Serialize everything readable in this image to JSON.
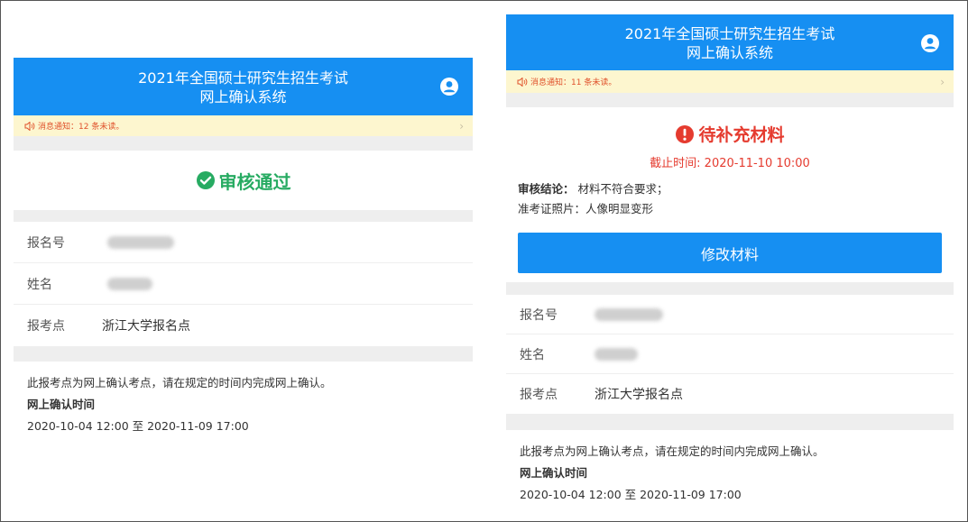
{
  "left": {
    "header": {
      "line1": "2021年全国硕士研究生招生考试",
      "line2": "网上确认系统"
    },
    "notice": {
      "text": "消息通知：12 条未读。",
      "arrow": "›"
    },
    "status": {
      "label": "审核通过",
      "color": "#27ab62"
    },
    "fields": [
      {
        "label": "报名号",
        "value": ""
      },
      {
        "label": "姓名",
        "value": ""
      },
      {
        "label": "报考点",
        "value": "浙江大学报名点"
      }
    ],
    "info": {
      "text": "此报考点为网上确认考点，请在规定的时间内完成网上确认。",
      "time_title": "网上确认时间",
      "time_range": "2020-10-04 12:00 至 2020-11-09 17:00"
    }
  },
  "right": {
    "header": {
      "line1": "2021年全国硕士研究生招生考试",
      "line2": "网上确认系统"
    },
    "notice": {
      "text": "消息通知：11 条未读。",
      "arrow": "›"
    },
    "status": {
      "label": "待补充材料",
      "color": "#e53b2f",
      "deadline": "截止时间: 2020-11-10 10:00",
      "conclusion_label": "审核结论：",
      "conclusion_value": "材料不符合要求；",
      "detail": "准考证照片：人像明显变形",
      "button": "修改材料"
    },
    "fields": [
      {
        "label": "报名号",
        "value": ""
      },
      {
        "label": "姓名",
        "value": ""
      },
      {
        "label": "报考点",
        "value": "浙江大学报名点"
      }
    ],
    "info": {
      "text": "此报考点为网上确认考点，请在规定的时间内完成网上确认。",
      "time_title": "网上确认时间",
      "time_range": "2020-10-04 12:00 至 2020-11-09 17:00"
    }
  },
  "colors": {
    "header_bg": "#168ff2",
    "notice_bg": "#fdf6cf",
    "notice_text": "#e0512b"
  },
  "icons": {
    "avatar": "user-circle-icon",
    "speaker": "speaker-icon",
    "ok": "check-circle-icon",
    "warn": "exclamation-circle-icon"
  }
}
